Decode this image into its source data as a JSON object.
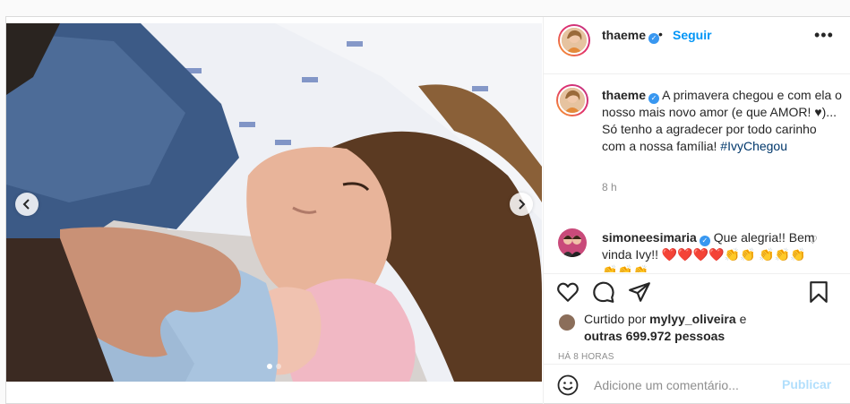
{
  "post": {
    "carousel": {
      "slides": 2,
      "active_index": 0
    },
    "header": {
      "username": "thaeme",
      "separator": "•",
      "follow_label": "Seguir",
      "more_label": "•••"
    },
    "caption": {
      "username": "thaeme",
      "text": "A primavera chegou e com ela o nosso mais novo amor (e que AMOR! ♥)... Só tenho a agradecer por todo carinho com a nossa família!",
      "hashtag": "#IvyChegou",
      "time": "8 h"
    },
    "comments": [
      {
        "username": "simoneesimaria",
        "text": "Que alegria!! Bem vinda Ivy!! ❤️❤️❤️❤️👏👏 👏👏👏👏👏👏"
      }
    ],
    "likes": {
      "prefix": "Curtido por",
      "user": "mylyy_oliveira",
      "conjunction": "e",
      "others": "outras 699.972 pessoas"
    },
    "posted_ago": "HÁ 8 HORAS",
    "add_comment": {
      "placeholder": "Adicione um comentário...",
      "publish_label": "Publicar"
    }
  },
  "colors": {
    "accent": "#0095f6",
    "publish_disabled": "#b2dffc",
    "verified": "#3897f0",
    "meta_text": "#8e8e8e",
    "hashtag": "#00376b"
  }
}
